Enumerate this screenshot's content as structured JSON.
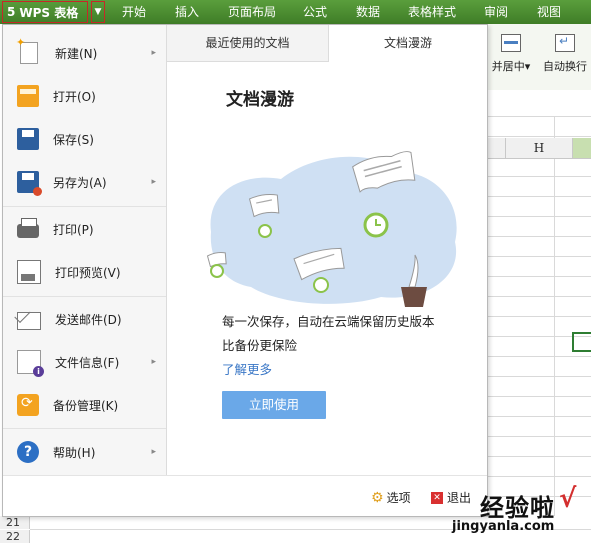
{
  "app": {
    "logo_glyph": "5",
    "name": "WPS 表格",
    "dropdown_glyph": "▼"
  },
  "menu_tabs": [
    "开始",
    "插入",
    "页面布局",
    "公式",
    "数据",
    "表格样式",
    "审阅",
    "视图"
  ],
  "ribbon": {
    "merge_label": "并居中",
    "merge_arrow": "▾",
    "wrap_label": "自动换行"
  },
  "sheet": {
    "column_header": "H",
    "rows": [
      "21",
      "22"
    ]
  },
  "file_menu": {
    "items": [
      {
        "label": "新建(N)",
        "has_submenu": true,
        "icon": "new-doc-icon"
      },
      {
        "label": "打开(O)",
        "has_submenu": false,
        "icon": "open-folder-icon"
      },
      {
        "label": "保存(S)",
        "has_submenu": false,
        "icon": "save-icon"
      },
      {
        "label": "另存为(A)",
        "has_submenu": true,
        "icon": "save-as-icon"
      },
      {
        "label": "打印(P)",
        "has_submenu": false,
        "icon": "printer-icon"
      },
      {
        "label": "打印预览(V)",
        "has_submenu": false,
        "icon": "print-preview-icon"
      },
      {
        "label": "发送邮件(D)",
        "has_submenu": false,
        "icon": "mail-icon"
      },
      {
        "label": "文件信息(F)",
        "has_submenu": true,
        "icon": "file-info-icon"
      },
      {
        "label": "备份管理(K)",
        "has_submenu": false,
        "icon": "backup-icon"
      },
      {
        "label": "帮助(H)",
        "has_submenu": true,
        "icon": "help-icon"
      }
    ],
    "chevron": "▸"
  },
  "panel": {
    "tabs": [
      {
        "label": "最近使用的文档",
        "active": false
      },
      {
        "label": "文档漫游",
        "active": true
      }
    ],
    "title": "文档漫游",
    "description_line1": "每一次保存，自动在云端保留历史版本",
    "description_line2": "比备份更保险",
    "learn_more": "了解更多",
    "use_now": "立即使用",
    "options": "选项",
    "exit": "退出"
  },
  "watermark": {
    "text": "经验啦",
    "check": "√",
    "url": "jingyanla.com"
  },
  "colors": {
    "ribbon_green": "#4a8c30",
    "accent_blue": "#6aa8e8",
    "link_blue": "#3a77c6",
    "highlight_red": "#c62828"
  }
}
